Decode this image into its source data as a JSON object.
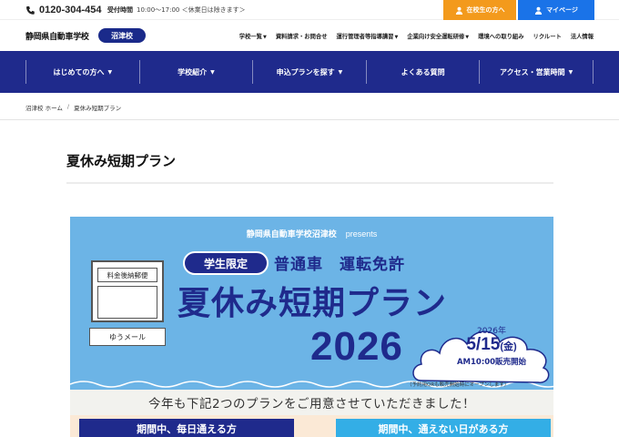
{
  "topbar": {
    "phone": "0120-304-454",
    "hours_label": "受付時間",
    "hours_text": "10:00〜17:00 ＜休業日は除きます＞",
    "student_button": "在校生の方へ",
    "mypage_button": "マイページ",
    "student_color": "#f39a1c",
    "mypage_color": "#1a73e8"
  },
  "header": {
    "logo": "静岡県自動車学校",
    "school_badge": "沼津校",
    "links": [
      {
        "label": "学校一覧",
        "has_caret": true
      },
      {
        "label": "資料請求・お問合せ",
        "has_caret": false
      },
      {
        "label": "運行管理者等指導講習",
        "has_caret": true
      },
      {
        "label": "企業向け安全運転研修",
        "has_caret": true
      },
      {
        "label": "環境への取り組み",
        "has_caret": false
      },
      {
        "label": "リクルート",
        "has_caret": false
      },
      {
        "label": "法人情報",
        "has_caret": false
      }
    ]
  },
  "mainnav": {
    "color": "#1f2a8c",
    "items": [
      {
        "label": "はじめての方へ",
        "caret": "▼"
      },
      {
        "label": "学校紹介",
        "caret": "▼"
      },
      {
        "label": "申込プランを探す",
        "caret": "▼"
      },
      {
        "label": "よくある質問",
        "caret": ""
      },
      {
        "label": "アクセス・営業時間",
        "caret": "▼"
      }
    ]
  },
  "breadcrumb": {
    "home": "沼津校 ホーム",
    "separator": "/",
    "current": "夏休み短期プラン"
  },
  "page": {
    "title": "夏休み短期プラン"
  },
  "banner": {
    "presents_jp": "静岡県自動車学校沼津校",
    "presents_en": "presents",
    "mail_label": "料金後納郵便",
    "yumail": "ゆうメール",
    "badge": "学生限定",
    "subtitle": "普通車　運転免許",
    "main_title": "夏休み短期プラン",
    "year": "2026",
    "sale_year": "2026年",
    "sale_date": "5/15",
    "sale_weekday": "(金)",
    "sale_time": "AM10:00販売開始",
    "note": "（予約用QRも販売開始時にオープンします）",
    "lead": "今年も下記2つのプランをご用意させていただきました！",
    "plan_a": "期間中、毎日通える方",
    "plan_b": "期間中、通えない日がある方",
    "bg_color": "#6cb4e6",
    "title_color": "#1f2a8c"
  }
}
